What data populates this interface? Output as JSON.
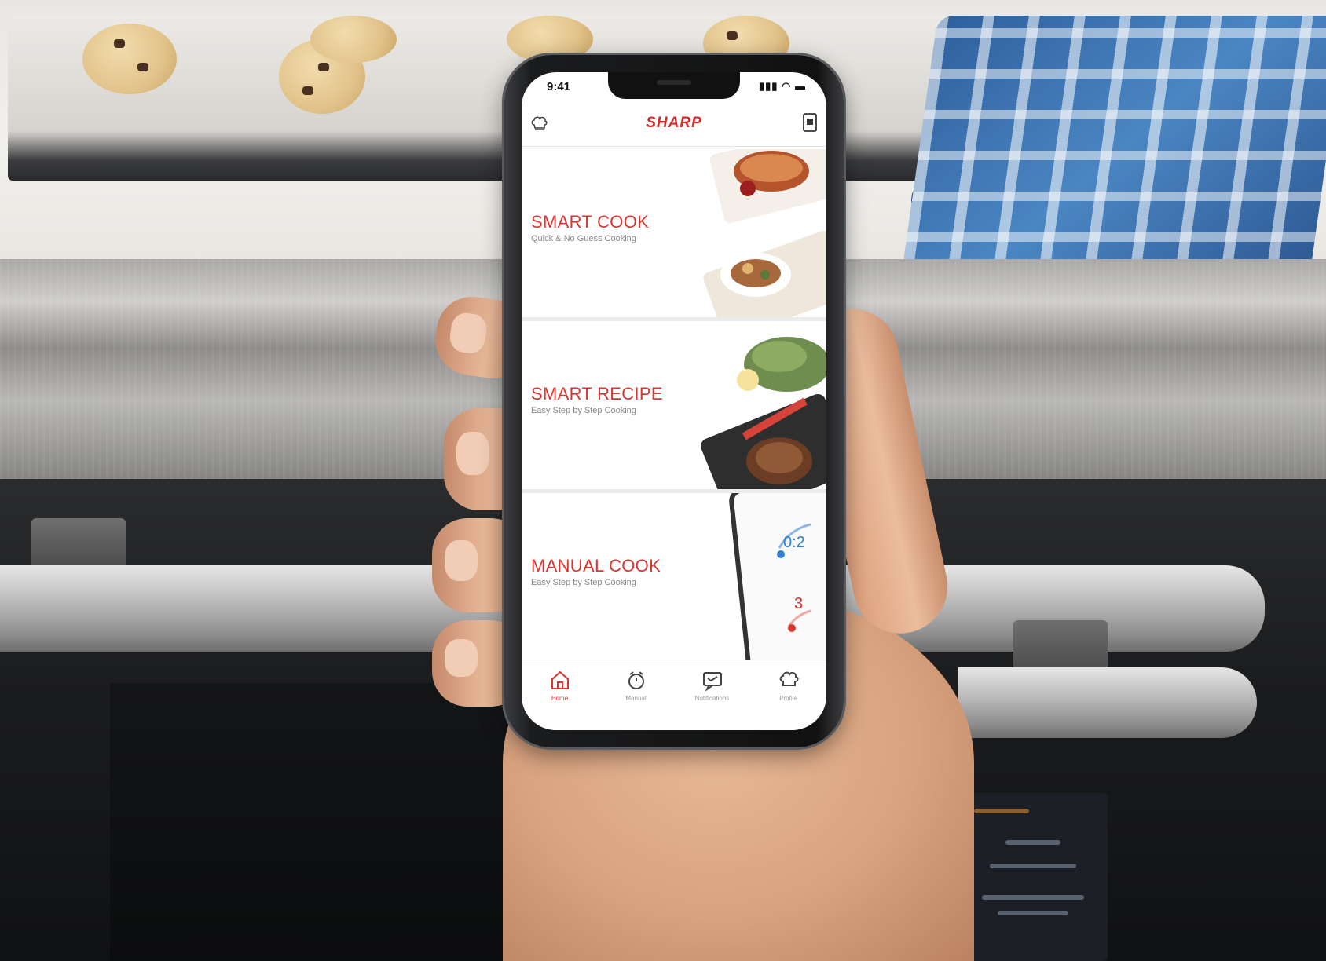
{
  "status_bar": {
    "time": "9:41",
    "icons": "▮▮▮ ◠ ▬"
  },
  "header": {
    "brand": "SHARP",
    "left_icon": "chef-hat-icon",
    "right_icon": "device-icon"
  },
  "cards": [
    {
      "title": "SMART COOK",
      "subtitle": "Quick & No Guess Cooking"
    },
    {
      "title": "SMART RECIPE",
      "subtitle": "Easy Step by Step Cooking"
    },
    {
      "title": "MANUAL COOK",
      "subtitle": "Easy Step by Step Cooking"
    }
  ],
  "tabbar": {
    "tabs": [
      {
        "label": "Home",
        "icon": "home-icon",
        "active": true
      },
      {
        "label": "Manual",
        "icon": "timer-icon",
        "active": false
      },
      {
        "label": "Notifications",
        "icon": "message-icon",
        "active": false
      },
      {
        "label": "Profile",
        "icon": "chef-hat-icon",
        "active": false
      }
    ]
  },
  "manual_card_dial": {
    "value_top": "0:2",
    "value_bottom": "3"
  },
  "colors": {
    "accent": "#d9362f",
    "brand": "#d52b2b"
  }
}
